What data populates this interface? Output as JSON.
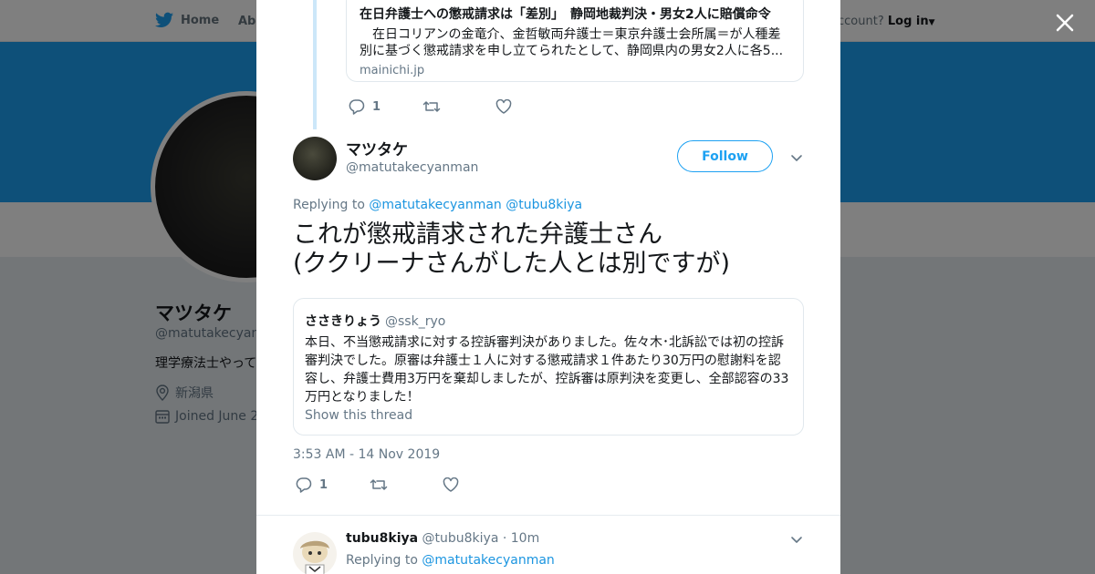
{
  "colors": {
    "accent": "#1da1f2",
    "link": "#1b95e0",
    "muted": "#657786",
    "text": "#14171a"
  },
  "nav": {
    "home": "Home",
    "about": "Abo",
    "account_prompt": "ccount?",
    "login": "Log in"
  },
  "profile": {
    "name": "マツタケ",
    "handle": "@matutakecyanm",
    "bio": "理学療法士やって",
    "location": "新潟県",
    "joined": "Joined June 2"
  },
  "link_card": {
    "title": "在日弁護士への懲戒請求は「差別」　静岡地裁判決・男女2人に賠償命令",
    "description": "　在日コリアンの金竜介、金哲敏両弁護士＝東京弁護士会所属＝が人種差別に基づく懲戒請求を申し立てられたとして、静岡県内の男女2人に各5...",
    "domain": "mainichi.jp"
  },
  "parent_actions": {
    "reply_count": "1"
  },
  "tweet": {
    "name": "マツタケ",
    "handle": "@matutakecyanman",
    "follow_label": "Follow",
    "replying_label": "Replying to",
    "replying_to_1": "@matutakecyanman",
    "replying_to_2": "@tubu8kiya",
    "text_line1": "これが懲戒請求された弁護士さん",
    "text_line2": "(ククリーナさんがした人とは別ですが)",
    "timestamp": "3:53 AM - 14 Nov 2019",
    "reply_count": "1"
  },
  "quote": {
    "name": "ささきりょう",
    "handle": "@ssk_ryo",
    "text": "本日、不当懲戒請求に対する控訴審判決がありました。佐々木･北訴訟では初の控訴審判決でした。原審は弁護士１人に対する懲戒請求１件あたり30万円の慰謝料を認容し、弁護士費用3万円を棄却しましたが、控訴審は原判決を変更し、全部認容の33万円となりました！",
    "show_thread": "Show this thread"
  },
  "reply": {
    "name": "tubu8kiya",
    "handle": "@tubu8kiya",
    "time": "· 10m",
    "replying_label": "Replying to",
    "replying_to": "@matutakecyanman"
  }
}
